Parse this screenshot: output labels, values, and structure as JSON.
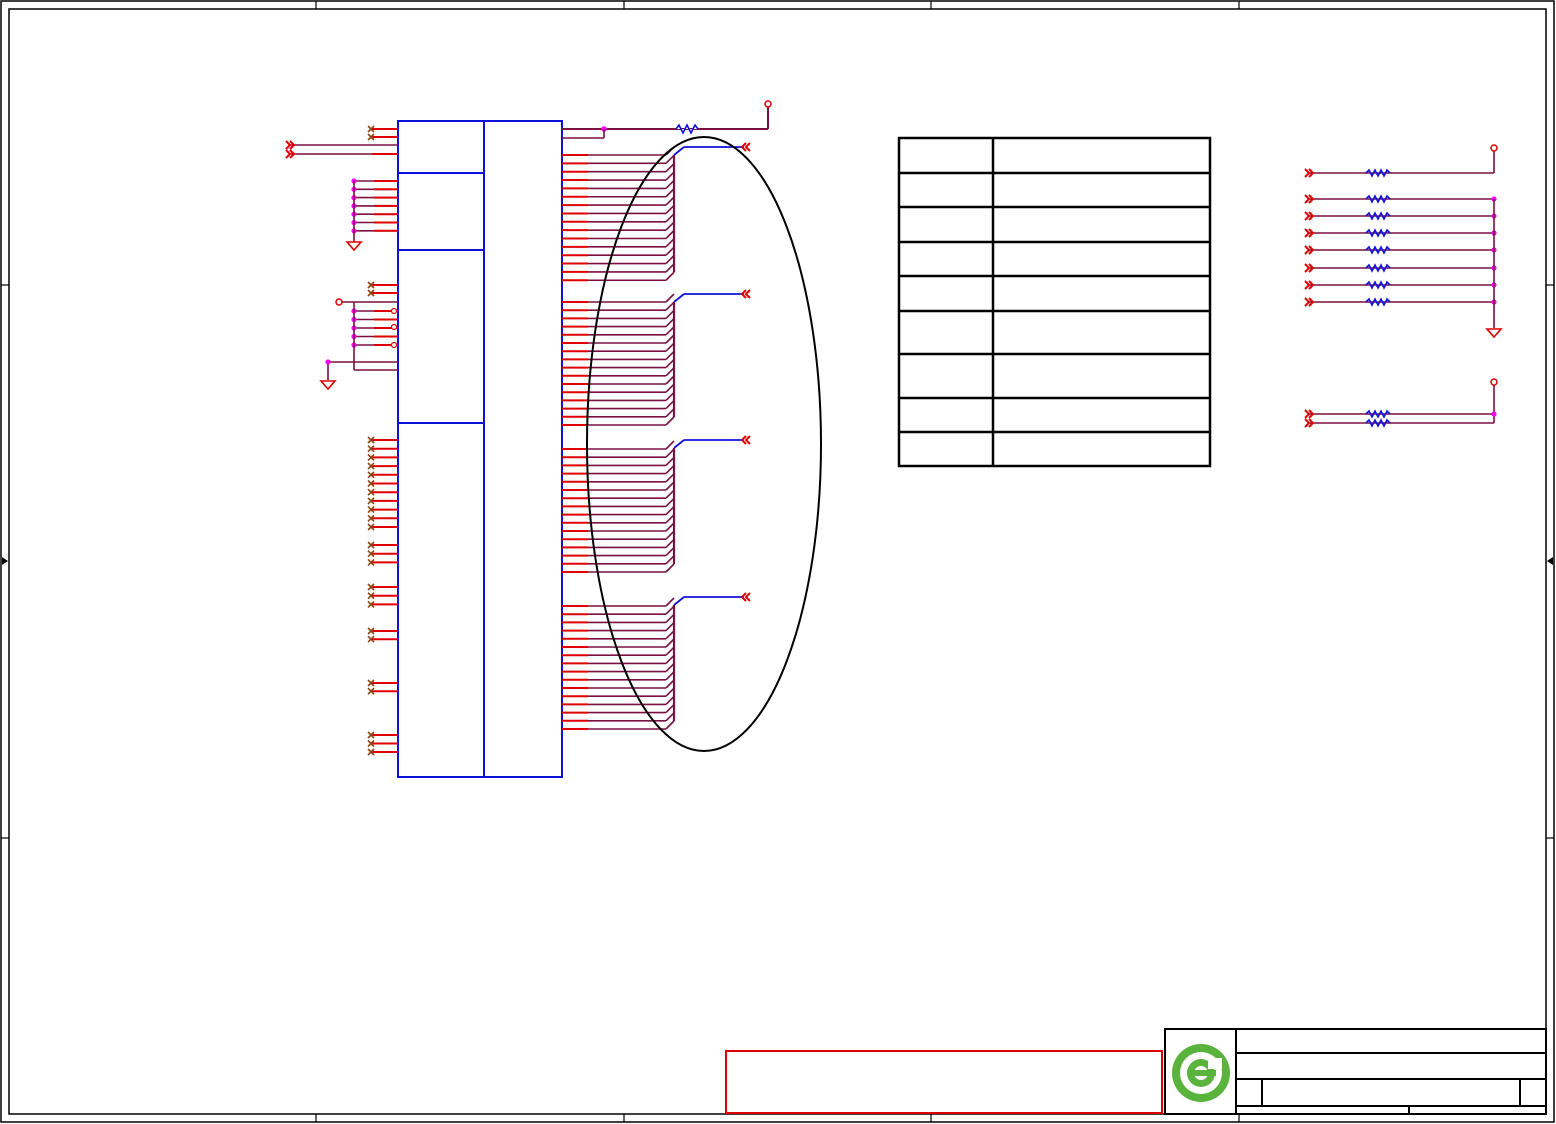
{
  "colors": {
    "frame": "#000000",
    "pin": "#e00000",
    "wire": "#7a1040",
    "part": "#1010dd",
    "junction": "#ff00ff",
    "noconnect": "#8b4513",
    "logo": "#5ab33c",
    "notice_box": "#dd0000"
  },
  "icons": [
    "offpage-connector-icon",
    "ground-symbol-icon",
    "power-port-icon",
    "no-connect-icon",
    "resistor-icon",
    "junction-dot-icon",
    "company-logo-icon"
  ],
  "schematic": {
    "left_netlabels": 2,
    "right_buses": 4,
    "resistor_rows_upper": 8,
    "resistor_rows_lower": 2,
    "table_rows": 9
  }
}
